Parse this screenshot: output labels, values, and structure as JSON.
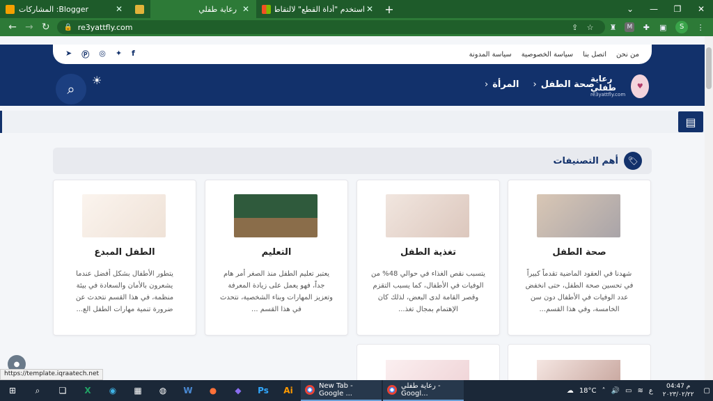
{
  "browser": {
    "tabs": [
      {
        "title": "المشاركات :Blogger",
        "color": "#f4a000",
        "active": false
      },
      {
        "title": "",
        "color": "#e2b33a",
        "active": false
      },
      {
        "title": "رعاية طفلي",
        "color": "#2d7a37",
        "active": true
      },
      {
        "title": "استخدم \"أداة القطع\" لالتقاط لقطا...",
        "color": "#f25022",
        "active": false
      }
    ],
    "url": "re3yattfly.com",
    "profile_initial": "S",
    "status_url": "https://template.iqraatech.net"
  },
  "site": {
    "social": [
      "facebook-icon",
      "twitter-icon",
      "instagram-icon",
      "pinterest-icon",
      "telegram-icon"
    ],
    "top_links": [
      "من نحن",
      "اتصل بنا",
      "سياسة الخصوصية",
      "سياسة المدونة"
    ],
    "logo_title": "رعاية طفلي",
    "logo_sub": "re3yattfly.com",
    "nav": [
      "صحة الطفل",
      "المرأة"
    ],
    "section_title": "أهم التصنيفات",
    "categories": [
      {
        "title": "صحة الطفل",
        "desc": "شهدنا في العقود الماضية تقدماً كبيراً في تحسين صحة الطفل، حتى انخفض عدد الوفيات في الأطفال دون سن الخامسة، وفي هذا القسم...",
        "img": "#c9b8a8",
        "img_label": "صحة الطفل"
      },
      {
        "title": "تغذية الطفل",
        "desc": "يتسبب نقص الغذاء في حوالي 48% من الوفيات في الأطفال، كما يسبب التقزم وقصر القامة لدى البعض، لذلك كان الإهتمام بمجال تغذ...",
        "img": "#eadfd8",
        "img_label": "تغذية الطفل"
      },
      {
        "title": "التعليم",
        "desc": "يعتبر تعليم الطفل منذ الصغر أمر هام جداً، فهو يعمل على زيادة المعرفة وتعزيز المهارات وبناء الشخصية، نتحدث في هذا القسم ...",
        "img": "#2f5a3c",
        "img_label": "التعليم"
      },
      {
        "title": "الطفل المبدع",
        "desc": "يتطور الأطفال بشكل أفضل عندما يشعرون بالأمان والسعادة في بيئة منظمة، في هذا القسم نتحدث عن ضرورة تنمية مهارات الطفل الع...",
        "img": "#f6efe9",
        "img_label": "الطفل المبدع"
      }
    ]
  },
  "taskbar": {
    "apps": [
      {
        "title": "New Tab - Google ..."
      },
      {
        "title": "رعاية طفلي - Googl..."
      }
    ],
    "temp": "18°C",
    "lang": "ع",
    "time": "04:47 م",
    "date": "٢٠٢٣/٠٢/٢٢"
  }
}
